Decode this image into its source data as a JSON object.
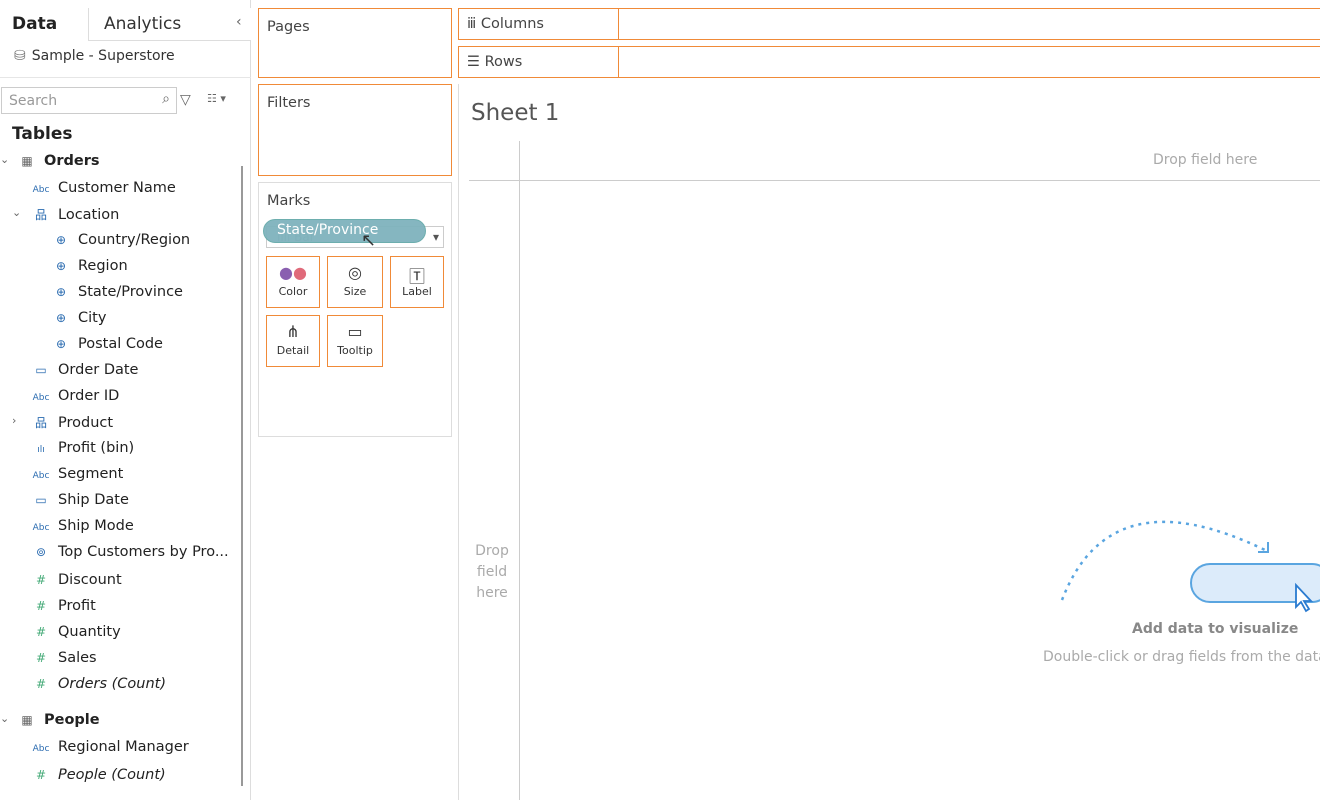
{
  "left_panel": {
    "tabs": [
      "Data",
      "Analytics"
    ],
    "collapse": "‹",
    "data_source": "Sample - Superstore",
    "search_placeholder": "Search",
    "tables_heading": "Tables",
    "fields": [
      {
        "label": "Orders",
        "icon": "▦",
        "type": "table",
        "expanded": "⌄"
      },
      {
        "label": "Customer Name",
        "icon": "Abc",
        "type": "dim"
      },
      {
        "label": "Location",
        "icon": "品",
        "type": "hier",
        "expanded": "⌄"
      },
      {
        "label": "Country/Region",
        "icon": "⊕",
        "type": "geo"
      },
      {
        "label": "Region",
        "icon": "⊕",
        "type": "geo"
      },
      {
        "label": "State/Province",
        "icon": "⊕",
        "type": "geo"
      },
      {
        "label": "City",
        "icon": "⊕",
        "type": "geo"
      },
      {
        "label": "Postal Code",
        "icon": "⊕",
        "type": "geo"
      },
      {
        "label": "Order Date",
        "icon": "▭",
        "type": "date"
      },
      {
        "label": "Order ID",
        "icon": "Abc",
        "type": "dim"
      },
      {
        "label": "Product",
        "icon": "品",
        "type": "hier",
        "expanded": "›"
      },
      {
        "label": "Profit (bin)",
        "icon": "ılı",
        "type": "dim"
      },
      {
        "label": "Segment",
        "icon": "Abc",
        "type": "dim"
      },
      {
        "label": "Ship Date",
        "icon": "▭",
        "type": "date"
      },
      {
        "label": "Ship Mode",
        "icon": "Abc",
        "type": "dim"
      },
      {
        "label": "Top Customers by Pro...",
        "icon": "⊚",
        "type": "set"
      },
      {
        "label": "Discount",
        "icon": "#",
        "type": "measure"
      },
      {
        "label": "Profit",
        "icon": "#",
        "type": "measure"
      },
      {
        "label": "Quantity",
        "icon": "#",
        "type": "measure"
      },
      {
        "label": "Sales",
        "icon": "#",
        "type": "measure"
      },
      {
        "label": "Orders (Count)",
        "icon": "#",
        "type": "measure-italic"
      },
      {
        "label": "People",
        "icon": "▦",
        "type": "table",
        "expanded": "⌄"
      },
      {
        "label": "Regional Manager",
        "icon": "Abc",
        "type": "dim"
      },
      {
        "label": "People (Count)",
        "icon": "#",
        "type": "measure-italic"
      }
    ]
  },
  "shelves": {
    "pages": "Pages",
    "filters": "Filters",
    "marks": "Marks",
    "columns": "Columns",
    "rows": "Rows"
  },
  "marks": {
    "mark_type": "Bar",
    "dragged_pill": "State/Province",
    "cards": [
      "Color",
      "Size",
      "Label",
      "Detail",
      "Tooltip"
    ]
  },
  "sheet": {
    "title": "Sheet 1",
    "drop_columns": "Drop field here",
    "drop_rows": [
      "Drop",
      "field",
      "here"
    ],
    "hint_title": "Add data to visualize",
    "hint_sub": "Double-click or drag fields from the data"
  },
  "colors": {
    "accent": "#f08a38",
    "pill": "#7fb3bd",
    "hint": "#5aa5e0"
  }
}
